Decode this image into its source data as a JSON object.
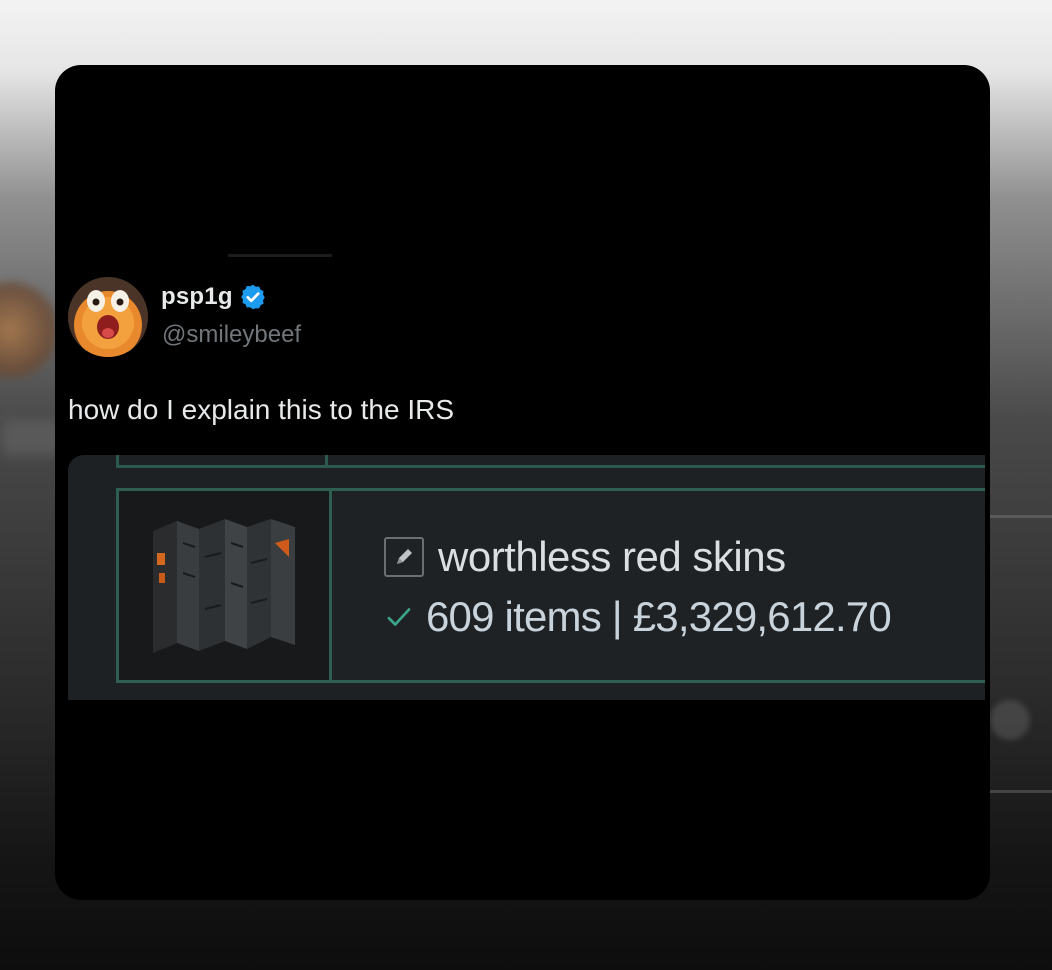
{
  "tweet": {
    "display_name": "psp1g",
    "handle": "@smileybeef",
    "verified": true,
    "text": "how do I explain this to the IRS"
  },
  "embedded_screenshot": {
    "inventory_name": "worthless red skins",
    "item_summary": "609 items | £3,329,612.70",
    "edit_icon": "pencil-icon",
    "status_icon": "check-icon"
  },
  "colors": {
    "verified_badge": "#1d9bf0",
    "accent_green": "#2f5f51",
    "check_green": "#3aa58a"
  }
}
